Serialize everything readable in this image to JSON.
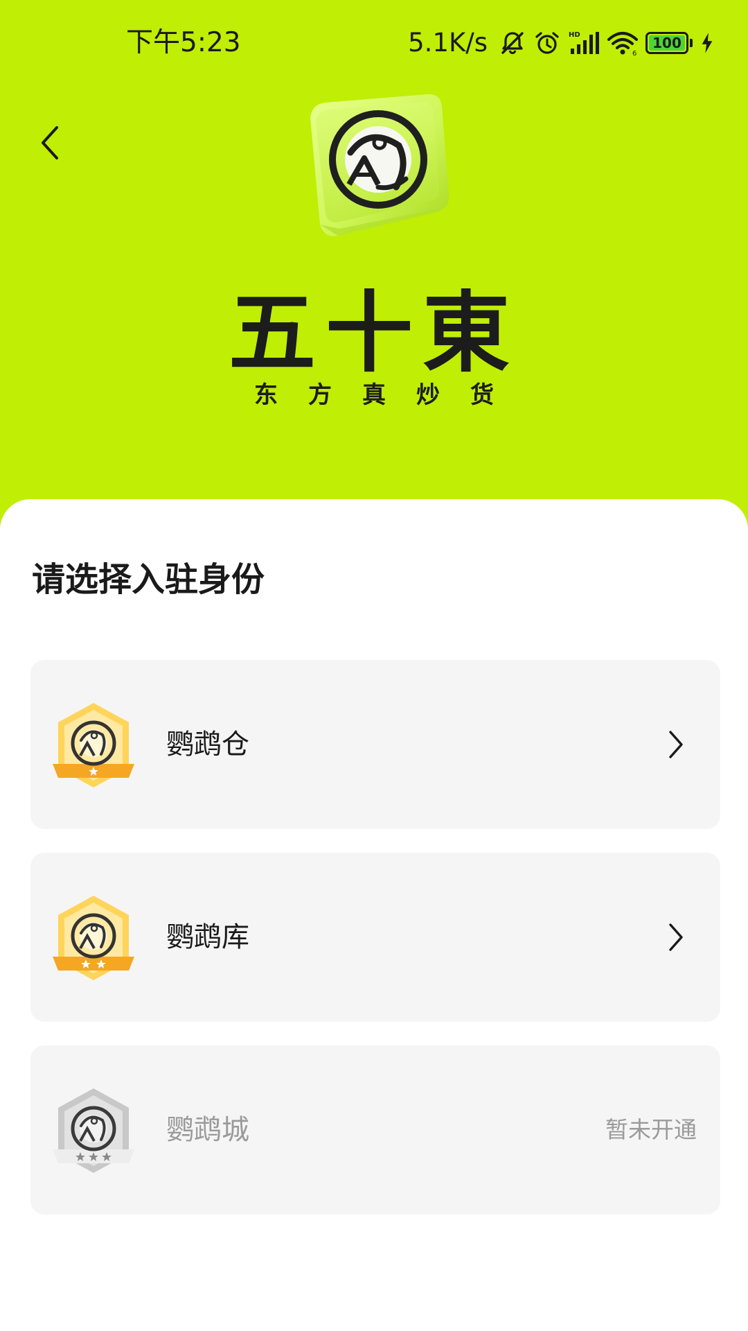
{
  "status_bar": {
    "time": "下午5:23",
    "net_speed": "5.1K/s",
    "battery": "100",
    "icons": [
      "bell-muted-icon",
      "alarm-icon",
      "hd-signal-icon",
      "wifi-icon",
      "battery-icon",
      "charging-icon"
    ]
  },
  "header": {
    "back_icon": "chevron-left-icon",
    "brand_title": "五十東",
    "brand_slogan": "东方真炒货",
    "logo_icon": "parrot-logo-icon"
  },
  "main": {
    "title": "请选择入驻身份",
    "options": [
      {
        "label": "鹦鹉仓",
        "stars": 1,
        "enabled": true,
        "icon": "badge-gold-icon",
        "action_icon": "chevron-right-icon"
      },
      {
        "label": "鹦鹉库",
        "stars": 2,
        "enabled": true,
        "icon": "badge-gold-icon",
        "action_icon": "chevron-right-icon"
      },
      {
        "label": "鹦鹉城",
        "stars": 3,
        "enabled": false,
        "icon": "badge-grey-icon",
        "status": "暂未开通"
      }
    ]
  },
  "colors": {
    "brand_green": "#C0EE04",
    "card_bg": "#F5F5F5",
    "badge_gold": "#FFC43D",
    "badge_grey": "#C8C8C8",
    "text_dark": "#1A1A1A",
    "text_muted": "#9A9A9A"
  }
}
